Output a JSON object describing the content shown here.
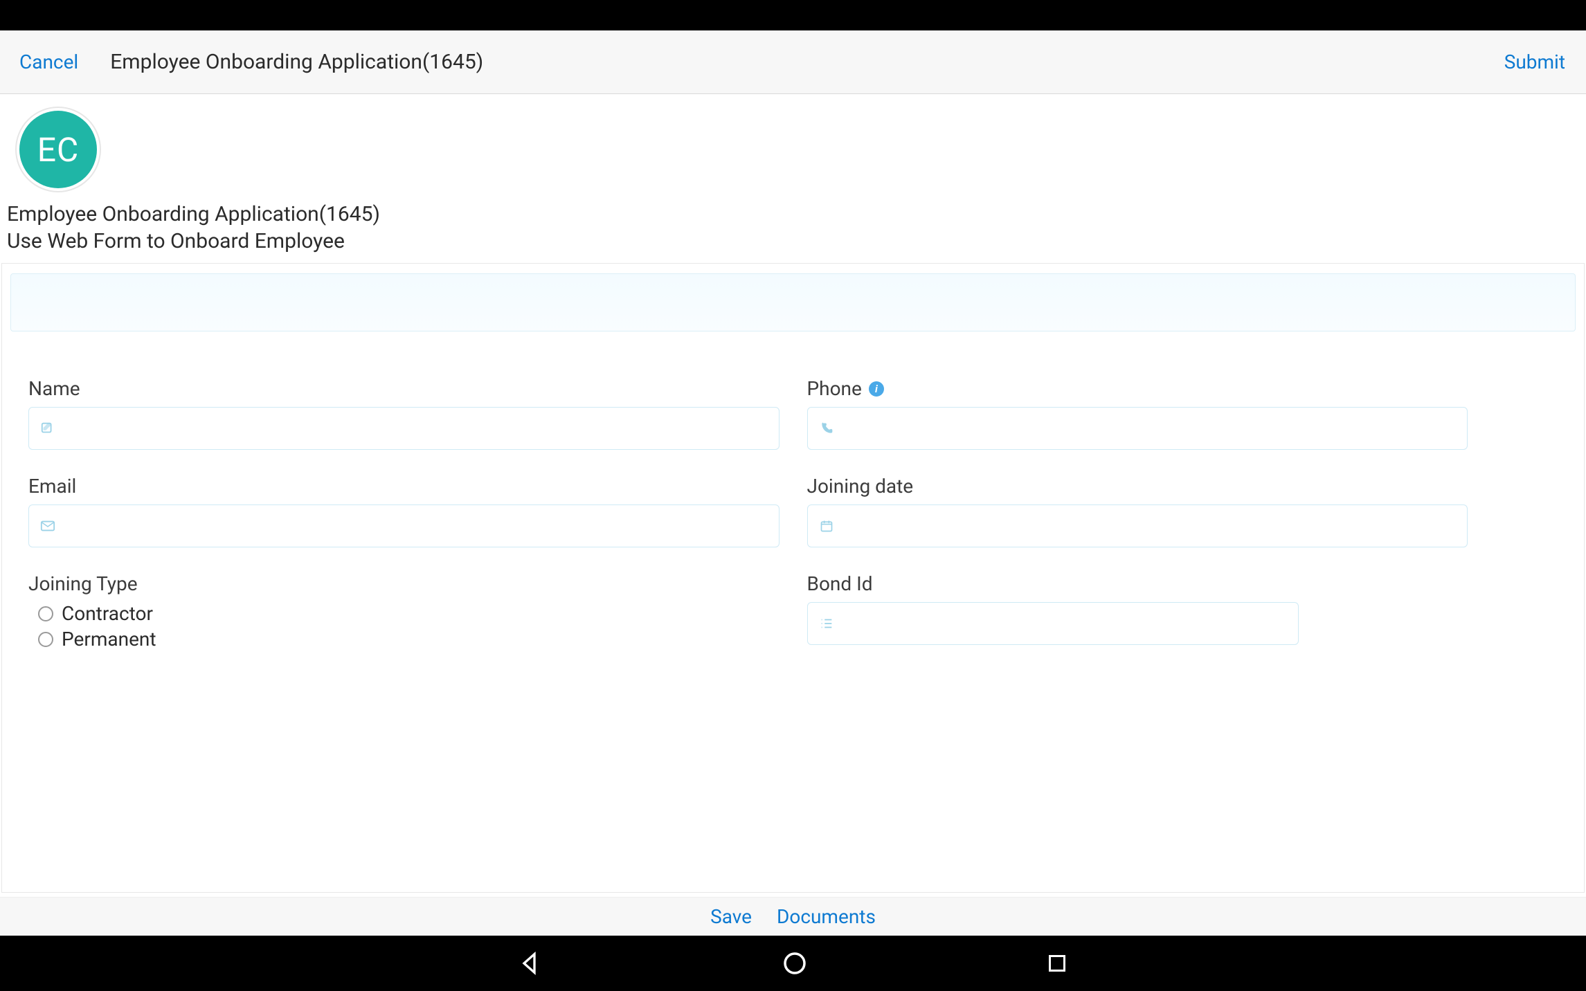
{
  "header": {
    "cancel_label": "Cancel",
    "title": "Employee Onboarding Application(1645)",
    "submit_label": "Submit"
  },
  "profile": {
    "avatar_initials": "EC",
    "title": "Employee Onboarding Application(1645)",
    "subtitle": "Use Web Form to Onboard Employee"
  },
  "form": {
    "name": {
      "label": "Name",
      "value": ""
    },
    "email": {
      "label": "Email",
      "value": ""
    },
    "joining_type": {
      "label": "Joining Type",
      "options": [
        "Contractor",
        "Permanent"
      ],
      "selected": null
    },
    "phone": {
      "label": "Phone",
      "value": ""
    },
    "joining_date": {
      "label": "Joining date",
      "value": ""
    },
    "bond_id": {
      "label": "Bond Id",
      "value": ""
    }
  },
  "footer": {
    "save_label": "Save",
    "documents_label": "Documents"
  },
  "icons": {
    "edit": "edit-icon",
    "mail": "mail-icon",
    "phone": "phone-icon",
    "calendar": "calendar-icon",
    "list": "list-icon",
    "info": "info-icon"
  },
  "colors": {
    "link": "#0e7ad1",
    "avatar_bg": "#1fb6a6",
    "input_border": "#cfeaf5",
    "icon": "#9bd2e7"
  }
}
